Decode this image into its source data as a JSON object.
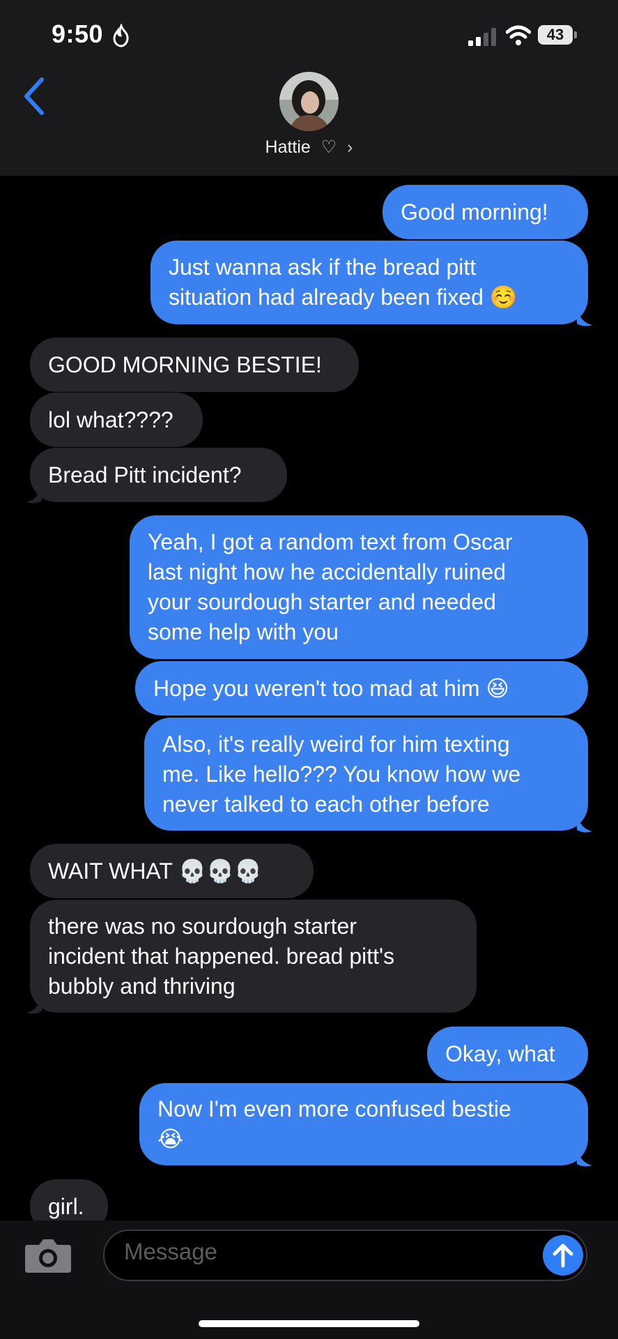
{
  "status_bar": {
    "time": "9:50",
    "battery": "43"
  },
  "header": {
    "contact_name": "Hattie",
    "heart": "♡",
    "chevron": "›"
  },
  "messages": [
    {
      "side": "out",
      "text": "Good morning!"
    },
    {
      "side": "out",
      "text": "Just wanna ask if the bread pitt\nsituation had already been fixed ☺️"
    },
    {
      "side": "in",
      "text": "GOOD MORNING BESTIE!"
    },
    {
      "side": "in",
      "text": "lol what????"
    },
    {
      "side": "in",
      "text": "Bread Pitt incident?"
    },
    {
      "side": "out",
      "text": "Yeah, I got a random text from Oscar\nlast night how he accidentally ruined\nyour sourdough starter and needed\nsome help with you"
    },
    {
      "side": "out",
      "text": "Hope you weren't too mad at him 😆"
    },
    {
      "side": "out",
      "text": "Also, it's really weird for him texting\nme. Like hello??? You know how we\nnever talked to each other before"
    },
    {
      "side": "in",
      "text": "WAIT WHAT 💀💀💀"
    },
    {
      "side": "in",
      "text": "there was no sourdough starter\nincident that happened. bread pitt's\nbubbly and thriving"
    },
    {
      "side": "out",
      "text": "Okay, what"
    },
    {
      "side": "out",
      "text": "Now I'm even more confused bestie\n😭"
    },
    {
      "side": "in",
      "text": "girl."
    }
  ],
  "composer": {
    "placeholder": "Message"
  },
  "icons": {
    "back": "chevron-left-icon",
    "camera": "camera-icon",
    "send": "arrow-up-icon"
  },
  "colors": {
    "outgoing": "#3b82f0",
    "incoming": "#26262a",
    "accent": "#2f7ef5"
  }
}
